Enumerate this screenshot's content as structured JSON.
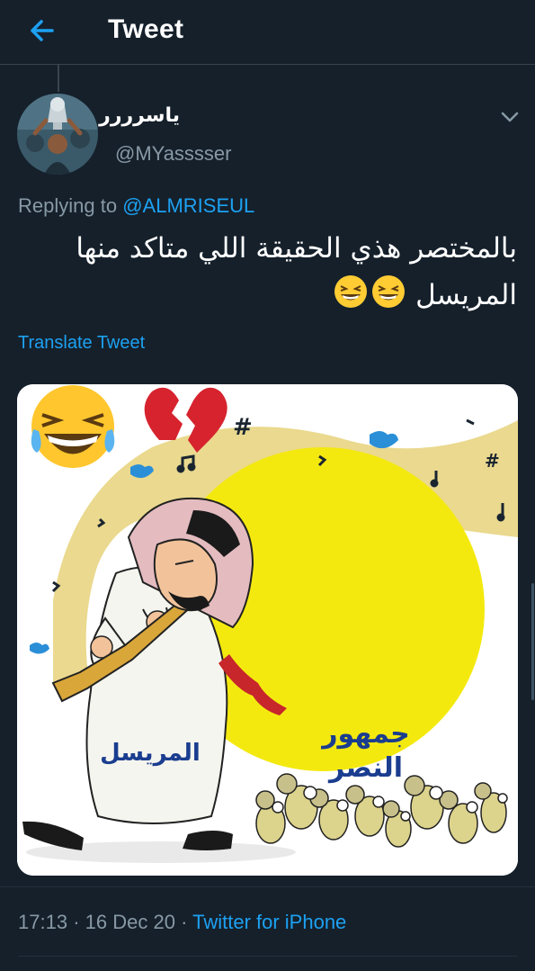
{
  "header": {
    "title": "Tweet",
    "back_icon": "arrow-left-icon"
  },
  "tweet": {
    "display_name": "ياسرررر",
    "handle": "@MYasssser",
    "replying_prefix": "Replying to",
    "replying_to": "@ALMRISEUL",
    "text_line_1": "بالمختصر هذي الحقيقة اللي متاكد منها",
    "text_line_2": "المريسل",
    "text_emoji": [
      "grinning-squinting-face-icon",
      "grinning-squinting-face-icon"
    ],
    "translate_label": "Translate Tweet",
    "time": "17:13",
    "separator": "·",
    "date": "16 Dec 20",
    "source": "Twitter for iPhone"
  },
  "media": {
    "caption_left": "المريسل",
    "caption_right_line1": "جمهور",
    "caption_right_line2": "النصر",
    "hashtag_symbol": "#"
  },
  "colors": {
    "background": "#15202b",
    "accent": "#1da1f2",
    "muted": "#8899a6",
    "border": "#38444d"
  }
}
